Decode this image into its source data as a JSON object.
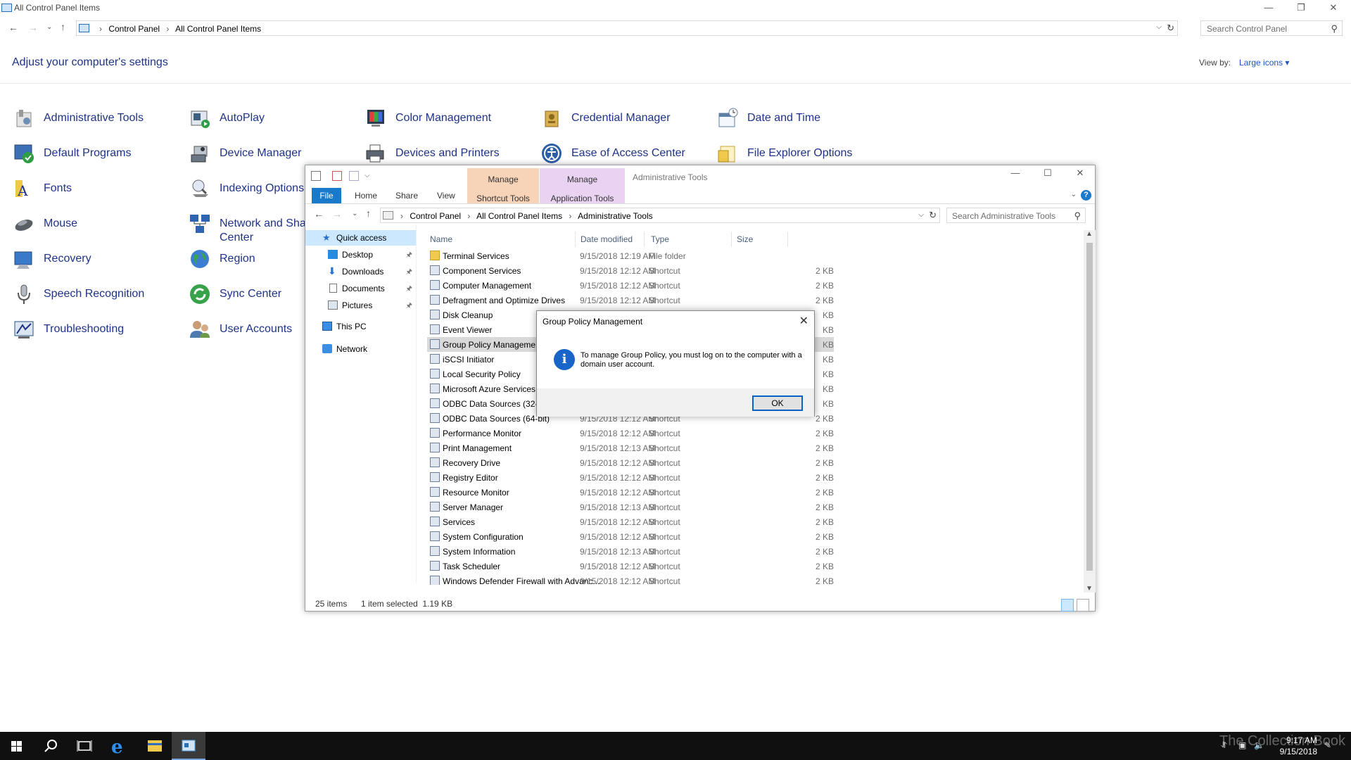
{
  "control_panel": {
    "window_title": "All Control Panel Items",
    "breadcrumb": [
      "Control Panel",
      "All Control Panel Items"
    ],
    "search_placeholder": "Search Control Panel",
    "heading": "Adjust your computer's settings",
    "view_by_label": "View by:",
    "view_by_value": "Large icons",
    "items": [
      {
        "label": "Administrative Tools",
        "icon": "admin-tools-icon"
      },
      {
        "label": "AutoPlay",
        "icon": "autoplay-icon"
      },
      {
        "label": "Color Management",
        "icon": "color-management-icon"
      },
      {
        "label": "Credential Manager",
        "icon": "credential-manager-icon"
      },
      {
        "label": "Date and Time",
        "icon": "date-time-icon"
      },
      {
        "label": "Default Programs",
        "icon": "default-programs-icon"
      },
      {
        "label": "Device Manager",
        "icon": "device-manager-icon"
      },
      {
        "label": "Devices and Printers",
        "icon": "printer-icon"
      },
      {
        "label": "Ease of Access Center",
        "icon": "ease-of-access-icon"
      },
      {
        "label": "File Explorer Options",
        "icon": "folder-options-icon"
      },
      {
        "label": "Fonts",
        "icon": "fonts-icon"
      },
      {
        "label": "Indexing Options",
        "icon": "indexing-icon"
      },
      {
        "label": "Mouse",
        "icon": "mouse-icon"
      },
      {
        "label": "Network and Sha",
        "label2": "Center",
        "icon": "network-icon"
      },
      {
        "label": "Recovery",
        "icon": "recovery-icon"
      },
      {
        "label": "Region",
        "icon": "region-icon"
      },
      {
        "label": "Speech Recognition",
        "icon": "microphone-icon"
      },
      {
        "label": "Sync Center",
        "icon": "sync-icon"
      },
      {
        "label": "Troubleshooting",
        "icon": "troubleshooting-icon"
      },
      {
        "label": "User Accounts",
        "icon": "user-accounts-icon"
      }
    ]
  },
  "explorer": {
    "title": "Administrative Tools",
    "context_tabs": [
      {
        "group": "Manage",
        "tab": "Shortcut Tools",
        "color": "#f7d3b8"
      },
      {
        "group": "Manage",
        "tab": "Application Tools",
        "color": "#ead2f3"
      }
    ],
    "tabs": [
      "File",
      "Home",
      "Share",
      "View"
    ],
    "help_label": "?",
    "breadcrumb": [
      "Control Panel",
      "All Control Panel Items",
      "Administrative Tools"
    ],
    "search_placeholder": "Search Administrative Tools",
    "nav": [
      {
        "label": "Quick access",
        "icon": "star-icon"
      },
      {
        "label": "Desktop",
        "icon": "desktop-icon"
      },
      {
        "label": "Downloads",
        "icon": "download-icon"
      },
      {
        "label": "Documents",
        "icon": "documents-icon"
      },
      {
        "label": "Pictures",
        "icon": "pictures-icon"
      },
      {
        "label": "This PC",
        "icon": "computer-icon"
      },
      {
        "label": "Network",
        "icon": "network-icon"
      }
    ],
    "columns": [
      "Name",
      "Date modified",
      "Type",
      "Size"
    ],
    "files": [
      {
        "name": "Terminal Services",
        "date": "9/15/2018 12:19 AM",
        "type": "File folder",
        "size": ""
      },
      {
        "name": "Component Services",
        "date": "9/15/2018 12:12 AM",
        "type": "Shortcut",
        "size": "2 KB"
      },
      {
        "name": "Computer Management",
        "date": "9/15/2018 12:12 AM",
        "type": "Shortcut",
        "size": "2 KB"
      },
      {
        "name": "Defragment and Optimize Drives",
        "date": "9/15/2018 12:12 AM",
        "type": "Shortcut",
        "size": "2 KB"
      },
      {
        "name": "Disk Cleanup",
        "date": "",
        "type": "",
        "size": "KB"
      },
      {
        "name": "Event Viewer",
        "date": "",
        "type": "",
        "size": "KB"
      },
      {
        "name": "Group Policy Manageme",
        "date": "",
        "type": "",
        "size": "KB"
      },
      {
        "name": "iSCSI Initiator",
        "date": "",
        "type": "",
        "size": "KB"
      },
      {
        "name": "Local Security Policy",
        "date": "",
        "type": "",
        "size": "KB"
      },
      {
        "name": "Microsoft Azure Services",
        "date": "",
        "type": "",
        "size": "KB"
      },
      {
        "name": "ODBC Data Sources (32-b",
        "date": "",
        "type": "",
        "size": "KB"
      },
      {
        "name": "ODBC Data Sources (64-bit)",
        "date": "9/15/2018 12:12 AM",
        "type": "Shortcut",
        "size": "2 KB"
      },
      {
        "name": "Performance Monitor",
        "date": "9/15/2018 12:12 AM",
        "type": "Shortcut",
        "size": "2 KB"
      },
      {
        "name": "Print Management",
        "date": "9/15/2018 12:13 AM",
        "type": "Shortcut",
        "size": "2 KB"
      },
      {
        "name": "Recovery Drive",
        "date": "9/15/2018 12:12 AM",
        "type": "Shortcut",
        "size": "2 KB"
      },
      {
        "name": "Registry Editor",
        "date": "9/15/2018 12:12 AM",
        "type": "Shortcut",
        "size": "2 KB"
      },
      {
        "name": "Resource Monitor",
        "date": "9/15/2018 12:12 AM",
        "type": "Shortcut",
        "size": "2 KB"
      },
      {
        "name": "Server Manager",
        "date": "9/15/2018 12:13 AM",
        "type": "Shortcut",
        "size": "2 KB"
      },
      {
        "name": "Services",
        "date": "9/15/2018 12:12 AM",
        "type": "Shortcut",
        "size": "2 KB"
      },
      {
        "name": "System Configuration",
        "date": "9/15/2018 12:12 AM",
        "type": "Shortcut",
        "size": "2 KB"
      },
      {
        "name": "System Information",
        "date": "9/15/2018 12:13 AM",
        "type": "Shortcut",
        "size": "2 KB"
      },
      {
        "name": "Task Scheduler",
        "date": "9/15/2018 12:12 AM",
        "type": "Shortcut",
        "size": "2 KB"
      },
      {
        "name": "Windows Defender Firewall with Advanc...",
        "date": "9/15/2018 12:12 AM",
        "type": "Shortcut",
        "size": "2 KB"
      }
    ],
    "status": {
      "count": "25 items",
      "selection": "1 item selected  1.19 KB"
    }
  },
  "dialog": {
    "title": "Group Policy Management",
    "message": "To manage Group Policy, you must log on to the computer with a domain user account.",
    "ok_label": "OK",
    "info_glyph": "i"
  },
  "taskbar": {
    "time": "9:17 AM",
    "date": "9/15/2018",
    "watermark": "The Collection Book"
  }
}
